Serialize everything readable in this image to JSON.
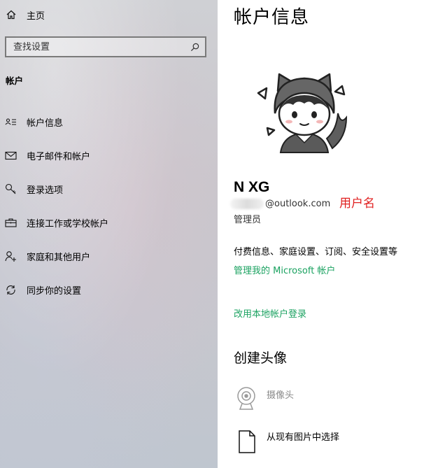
{
  "sidebar": {
    "home_label": "主页",
    "search_placeholder": "查找设置",
    "section_title": "帐户",
    "items": [
      {
        "label": "帐户信息",
        "icon": "account-info-icon"
      },
      {
        "label": "电子邮件和帐户",
        "icon": "mail-icon"
      },
      {
        "label": "登录选项",
        "icon": "key-icon"
      },
      {
        "label": "连接工作或学校帐户",
        "icon": "briefcase-icon"
      },
      {
        "label": "家庭和其他用户",
        "icon": "person-add-icon"
      },
      {
        "label": "同步你的设置",
        "icon": "sync-icon"
      }
    ]
  },
  "main": {
    "title": "帐户信息",
    "user_name": "N XG",
    "email_suffix": "@outlook.com",
    "annotation": "用户名",
    "role": "管理员",
    "billing_text": "付费信息、家庭设置、订阅、安全设置等",
    "manage_link": "管理我的 Microsoft 帐户",
    "local_link": "改用本地帐户登录",
    "create_avatar_title": "创建头像",
    "camera_label": "摄像头",
    "browse_label": "从现有图片中选择"
  },
  "colors": {
    "link": "#1aa260",
    "annotation": "#e02020",
    "disabled_text": "#8a8a8a"
  }
}
